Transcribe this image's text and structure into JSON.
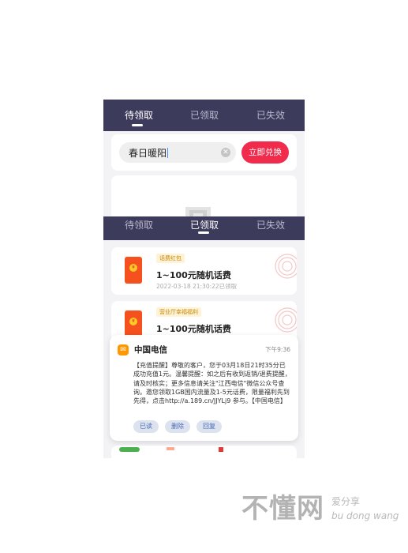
{
  "top_screen": {
    "tabs": [
      {
        "label": "待领取",
        "active": true
      },
      {
        "label": "已领取",
        "active": false
      },
      {
        "label": "已失效",
        "active": false
      }
    ],
    "redeem": {
      "input_value": "春日暖阳",
      "button_label": "立即兑换"
    },
    "colors": {
      "tabbar": "#3d3b5c",
      "accent": "#f02b4c"
    }
  },
  "bottom_screen": {
    "tabs": [
      {
        "label": "待领取",
        "active": false
      },
      {
        "label": "已领取",
        "active": true
      },
      {
        "label": "已失效",
        "active": false
      }
    ],
    "coupons": [
      {
        "tag": "话费红包",
        "title": "1~100元随机话费",
        "time": "2022-03-18 21:30:22已领取"
      },
      {
        "tag": "营业厅幸福福利",
        "title": "1~100元随机话费",
        "time": ""
      }
    ],
    "notification": {
      "app_name": "中国电信",
      "time": "下午9:36",
      "body": "【充值提醒】尊敬的客户，您于03月18日21时35分已成功充值1元。温馨提醒：如之后有收到返销/退费提醒，请及时核实；更多信息请关注\"江西电信\"微信公众号查询。邀您领取1GB国内流量及1-5元话费，限量福利先到先得，点击http://a.189.cn/JJYLj9 参与。【中国电信】",
      "actions": [
        "已读",
        "删除",
        "回复"
      ]
    }
  },
  "watermark": {
    "main": "不懂网",
    "tagline": "爱分享",
    "pinyin": "bu dong wang"
  }
}
